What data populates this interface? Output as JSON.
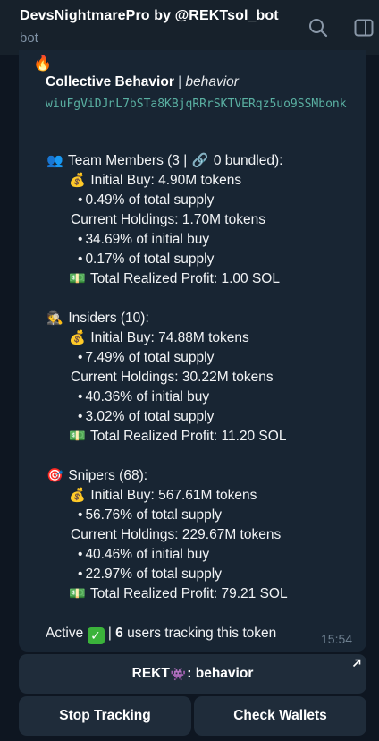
{
  "header": {
    "title": "DevsNightmarePro by @REKTsol_bot",
    "subtitle": "bot",
    "icons": [
      "search-icon",
      "side-panel-icon"
    ]
  },
  "message": {
    "fire_emoji": "🔥",
    "title_bold": "Collective Behavior",
    "title_sep": " | ",
    "title_italic": "behavior",
    "token_address": "wiuFgViDJnL7bSTa8KBjqRRrSKTVERqz5uo9SSMbonk",
    "team": {
      "emoji": "👥",
      "header": "Team Members (3 | ",
      "link_emoji": "🔗",
      "header_tail": " 0 bundled):",
      "initial_emoji": "💰",
      "initial_buy": "Initial Buy: 4.90M tokens",
      "initial_pct": "0.49% of total supply",
      "holdings": "Current Holdings: 1.70M tokens",
      "holdings_pct_initial": "34.69% of initial buy",
      "holdings_pct_supply": "0.17% of total supply",
      "profit_emoji": "💵",
      "profit": "Total Realized Profit: 1.00 SOL"
    },
    "insiders": {
      "emoji": "🕵",
      "header": "Insiders (10):",
      "initial_emoji": "💰",
      "initial_buy": "Initial Buy: 74.88M tokens",
      "initial_pct": "7.49% of total supply",
      "holdings": "Current Holdings: 30.22M tokens",
      "holdings_pct_initial": "40.36% of initial buy",
      "holdings_pct_supply": "3.02% of total supply",
      "profit_emoji": "💵",
      "profit": "Total Realized Profit: 11.20 SOL"
    },
    "snipers": {
      "emoji": "🎯",
      "header": "Snipers (68):",
      "initial_emoji": "💰",
      "initial_buy": "Initial Buy: 567.61M tokens",
      "initial_pct": "56.76% of total supply",
      "holdings": "Current Holdings: 229.67M tokens",
      "holdings_pct_initial": "40.46% of initial buy",
      "holdings_pct_supply": "22.97% of total supply",
      "profit_emoji": "💵",
      "profit": "Total Realized Profit: 79.21 SOL"
    },
    "bullet": "•",
    "active_label": "Active",
    "active_check": "✓",
    "active_sep": " | ",
    "tracking_count": "6",
    "tracking_text": " users tracking this token",
    "time": "15:54"
  },
  "keyboard": {
    "rekt_prefix": "REKT",
    "rekt_emoji": "👾",
    "rekt_suffix": ": behavior",
    "stop_label": "Stop Tracking",
    "check_label": "Check Wallets"
  },
  "colors": {
    "background": "#0e1621",
    "header": "#17212b",
    "bubble": "#182533",
    "button": "#1f2c3a",
    "address": "#5ab0a2",
    "check": "#3bb33b"
  }
}
